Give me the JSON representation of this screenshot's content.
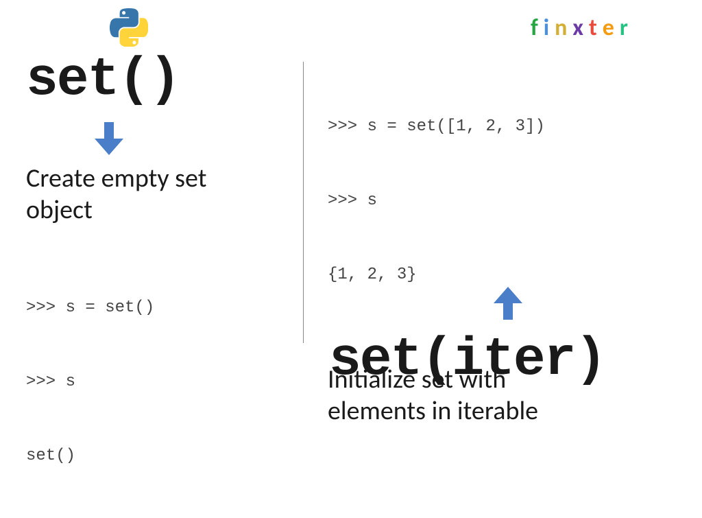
{
  "brand": {
    "letters": [
      "f",
      "i",
      "n",
      "x",
      "t",
      "e",
      "r"
    ]
  },
  "left": {
    "title": "set()",
    "desc_line1": "Create empty set",
    "desc_line2": "object",
    "code_line1": ">>> s = set()",
    "code_line2": ">>> s",
    "code_line3": "set()"
  },
  "right": {
    "title": "set(iter)",
    "desc_line1": "Initialize set with",
    "desc_line2": "elements in iterable",
    "code_line1": ">>> s = set([1, 2, 3])",
    "code_line2": ">>> s",
    "code_line3": "{1, 2, 3}"
  }
}
